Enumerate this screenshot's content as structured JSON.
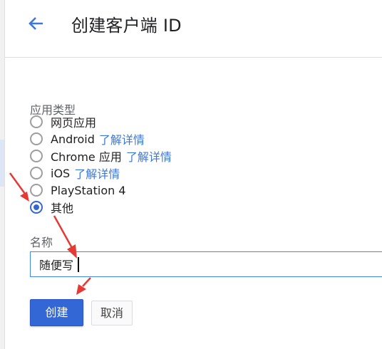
{
  "header": {
    "title": "创建客户端 ID",
    "back_icon": "arrow-left-icon"
  },
  "app_type": {
    "label": "应用类型",
    "options": [
      {
        "label": "网页应用",
        "link": "",
        "checked": false
      },
      {
        "label": "Android",
        "link": "了解详情",
        "checked": false
      },
      {
        "label": "Chrome 应用",
        "link": "了解详情",
        "checked": false
      },
      {
        "label": "iOS",
        "link": "了解详情",
        "checked": false
      },
      {
        "label": "PlayStation 4",
        "link": "",
        "checked": false
      },
      {
        "label": "其他",
        "link": "",
        "checked": true
      }
    ]
  },
  "name_field": {
    "label": "名称",
    "value": "随便写"
  },
  "actions": {
    "create_label": "创建",
    "cancel_label": "取消"
  },
  "colors": {
    "accent": "#3367d6",
    "link": "#3b78d8",
    "annotation_arrow": "#e53935"
  }
}
